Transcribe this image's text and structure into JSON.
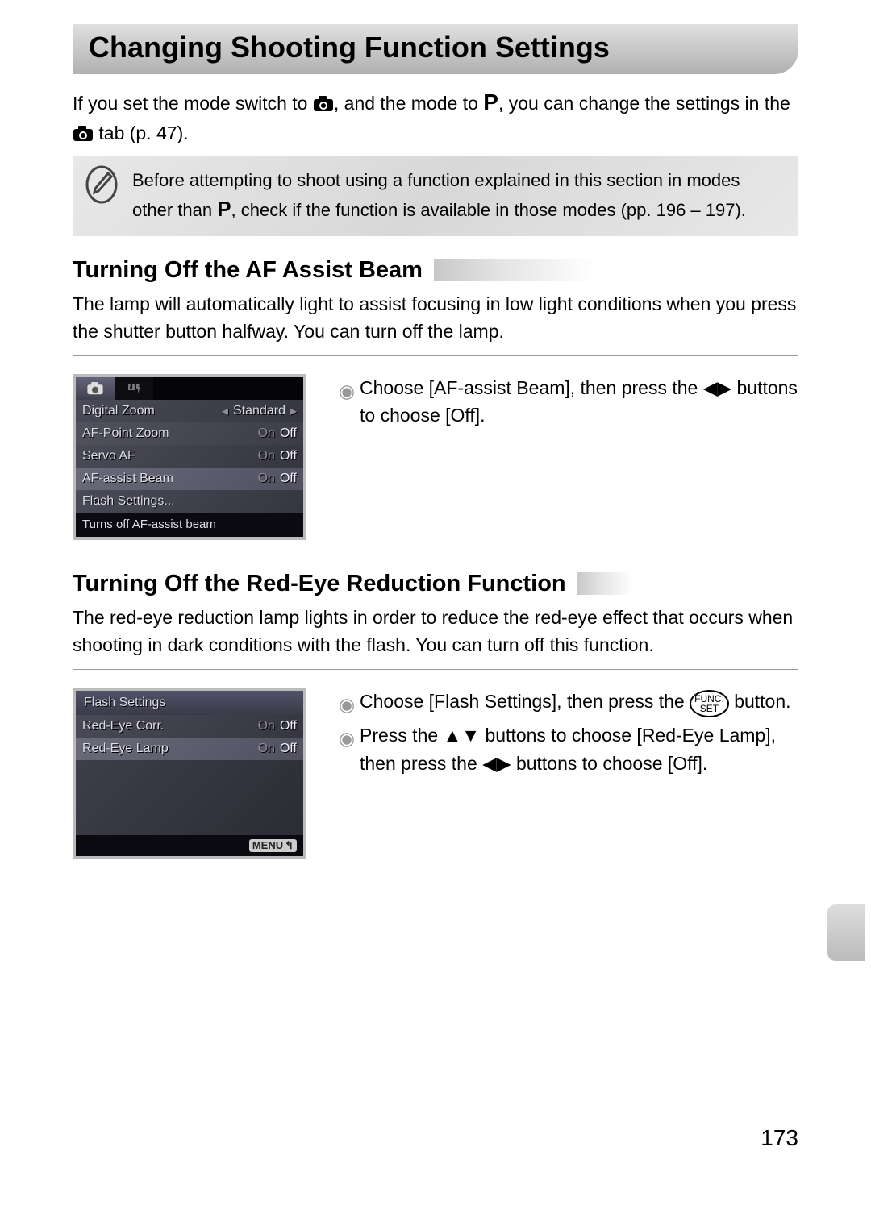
{
  "title": "Changing Shooting Function Settings",
  "intro": {
    "part1": "If you set the mode switch to ",
    "part2": ", and the mode to ",
    "part3": ", you can change the settings in the ",
    "part4": " tab (p. 47)."
  },
  "note": {
    "part1": "Before attempting to shoot using a function explained in this section in modes other than ",
    "part2": ", check if the function is available in those modes (pp. 196 – 197)."
  },
  "section1": {
    "heading": "Turning Off the AF Assist Beam",
    "body": "The lamp will automatically light to assist focusing in low light conditions when you press the shutter button halfway. You can turn off the lamp.",
    "instruction": {
      "part1": "Choose [AF-assist Beam], then press the ",
      "part2": " buttons to choose [Off]."
    },
    "screenshot": {
      "tab1": "camera",
      "tab2": "tools",
      "rows": [
        {
          "label": "Digital Zoom",
          "value": "Standard",
          "arrows": true
        },
        {
          "label": "AF-Point Zoom",
          "opts": [
            "On",
            "Off"
          ],
          "sel": 1
        },
        {
          "label": "Servo AF",
          "opts": [
            "On",
            "Off"
          ],
          "sel": 1
        },
        {
          "label": "AF-assist Beam",
          "opts": [
            "On",
            "Off"
          ],
          "sel": 1,
          "selected": true
        },
        {
          "label": "Flash Settings...",
          "value": ""
        }
      ],
      "footer": "Turns off AF-assist beam"
    }
  },
  "section2": {
    "heading": "Turning Off the Red-Eye Reduction Function",
    "body": "The red-eye reduction lamp lights in order to reduce the red-eye effect that occurs when shooting in dark conditions with the flash. You can turn off this function.",
    "inst1": {
      "part1": "Choose [Flash Settings], then press the ",
      "part2": " button."
    },
    "inst2": {
      "part1": "Press the ",
      "part2": " buttons to choose [Red-Eye Lamp], then press the ",
      "part3": " buttons to choose [Off]."
    },
    "screenshot": {
      "title": "Flash Settings",
      "rows": [
        {
          "label": "Red-Eye Corr.",
          "opts": [
            "On",
            "Off"
          ],
          "sel": 1
        },
        {
          "label": "Red-Eye Lamp",
          "opts": [
            "On",
            "Off"
          ],
          "sel": 1,
          "selected": true
        }
      ],
      "menu": "MENU"
    }
  },
  "funcset_label": "FUNC.\nSET",
  "page_number": "173"
}
